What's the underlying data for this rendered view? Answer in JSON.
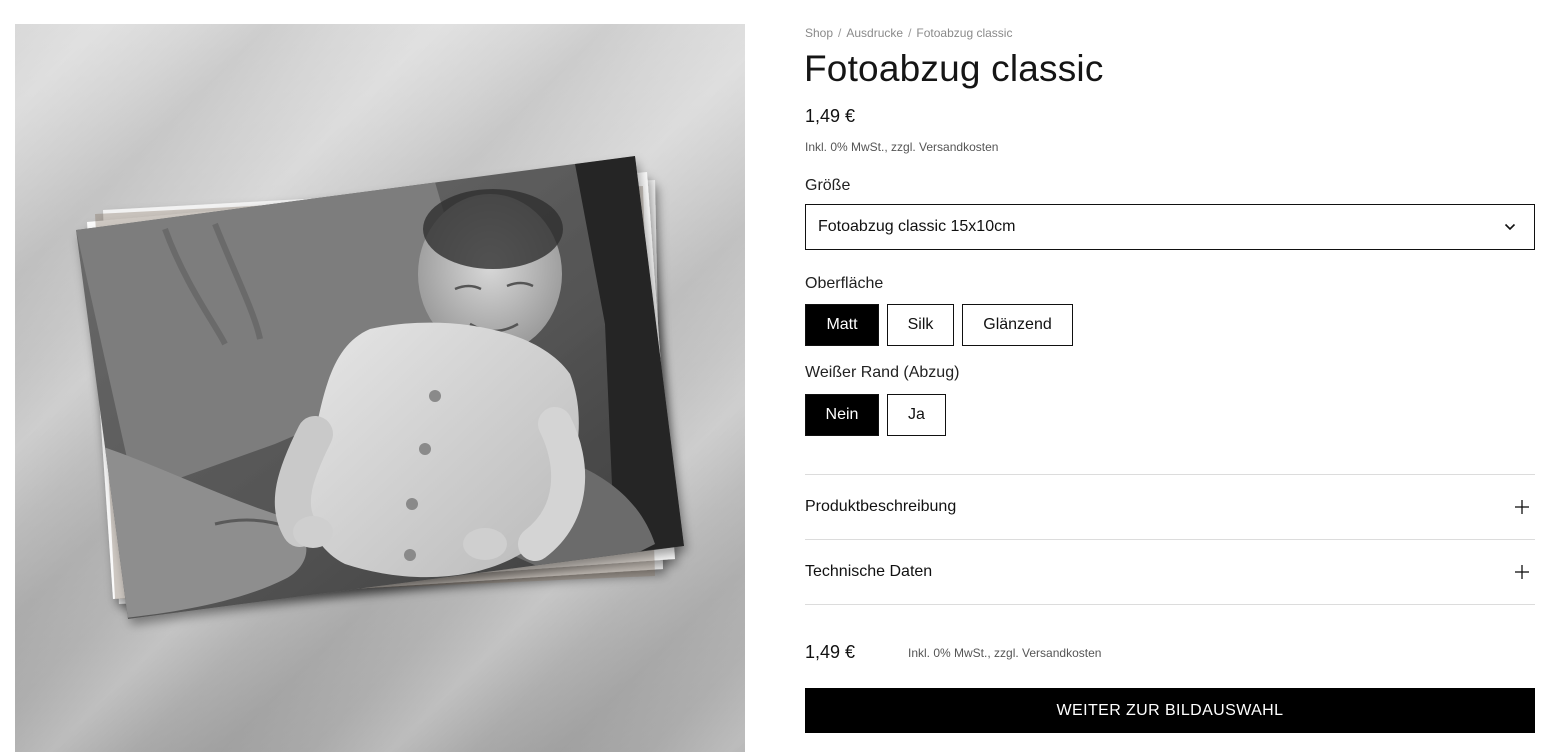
{
  "breadcrumb": [
    "Shop",
    "Ausdrucke",
    "Fotoabzug classic"
  ],
  "breadcrumb_separator": "/",
  "product": {
    "title": "Fotoabzug classic",
    "price": "1,49 €",
    "tax_note": "Inkl. 0% MwSt., zzgl. Versandkosten"
  },
  "options": {
    "size": {
      "label": "Größe",
      "selected": "Fotoabzug classic 15x10cm",
      "icon": "chevron-down-icon"
    },
    "surface": {
      "label": "Oberfläche",
      "choices": [
        "Matt",
        "Silk",
        "Glänzend"
      ],
      "selected": "Matt"
    },
    "white_border": {
      "label": "Weißer Rand (Abzug)",
      "choices": [
        "Nein",
        "Ja"
      ],
      "selected": "Nein"
    }
  },
  "accordion": [
    {
      "label": "Produktbeschreibung",
      "icon": "plus-icon"
    },
    {
      "label": "Technische Daten",
      "icon": "plus-icon"
    }
  ],
  "footer": {
    "price": "1,49 €",
    "tax_note": "Inkl. 0% MwSt., zzgl. Versandkosten",
    "cta_label": "WEITER ZUR BILDAUSWAHL"
  },
  "colors": {
    "accent": "#000000",
    "on_accent": "#ffffff",
    "border": "#111111",
    "divider": "#dcdcdc",
    "muted_text": "#555555"
  }
}
